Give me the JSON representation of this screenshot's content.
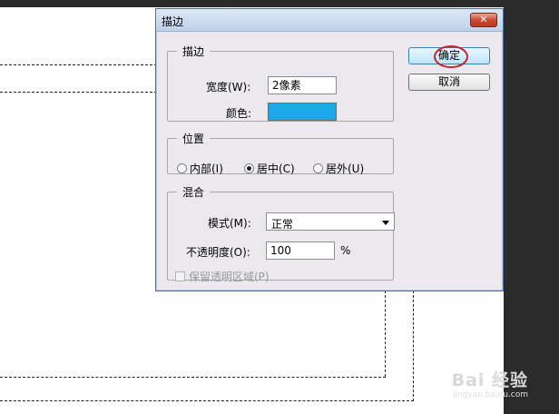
{
  "dialog": {
    "title": "描边",
    "close_glyph": "✕"
  },
  "stroke": {
    "legend": "描边",
    "width_label": "宽度(W):",
    "width_value": "2像素",
    "color_label": "颜色:",
    "color_hex": "#1ea7ea"
  },
  "position": {
    "legend": "位置",
    "options": [
      {
        "label": "内部(I)",
        "selected": false
      },
      {
        "label": "居中(C)",
        "selected": true
      },
      {
        "label": "居外(U)",
        "selected": false
      }
    ]
  },
  "blend": {
    "legend": "混合",
    "mode_label": "模式(M):",
    "mode_value": "正常",
    "opacity_label": "不透明度(O):",
    "opacity_value": "100",
    "opacity_unit": "%",
    "preserve_label": "保留透明区域(P)"
  },
  "buttons": {
    "ok": "确定",
    "cancel": "取消"
  },
  "watermark": {
    "brand": "Bai 经验",
    "url": "jingyan.baidu.com"
  },
  "colors": {
    "annotation": "#c8242e",
    "stroke_color": "#1ea7ea"
  }
}
